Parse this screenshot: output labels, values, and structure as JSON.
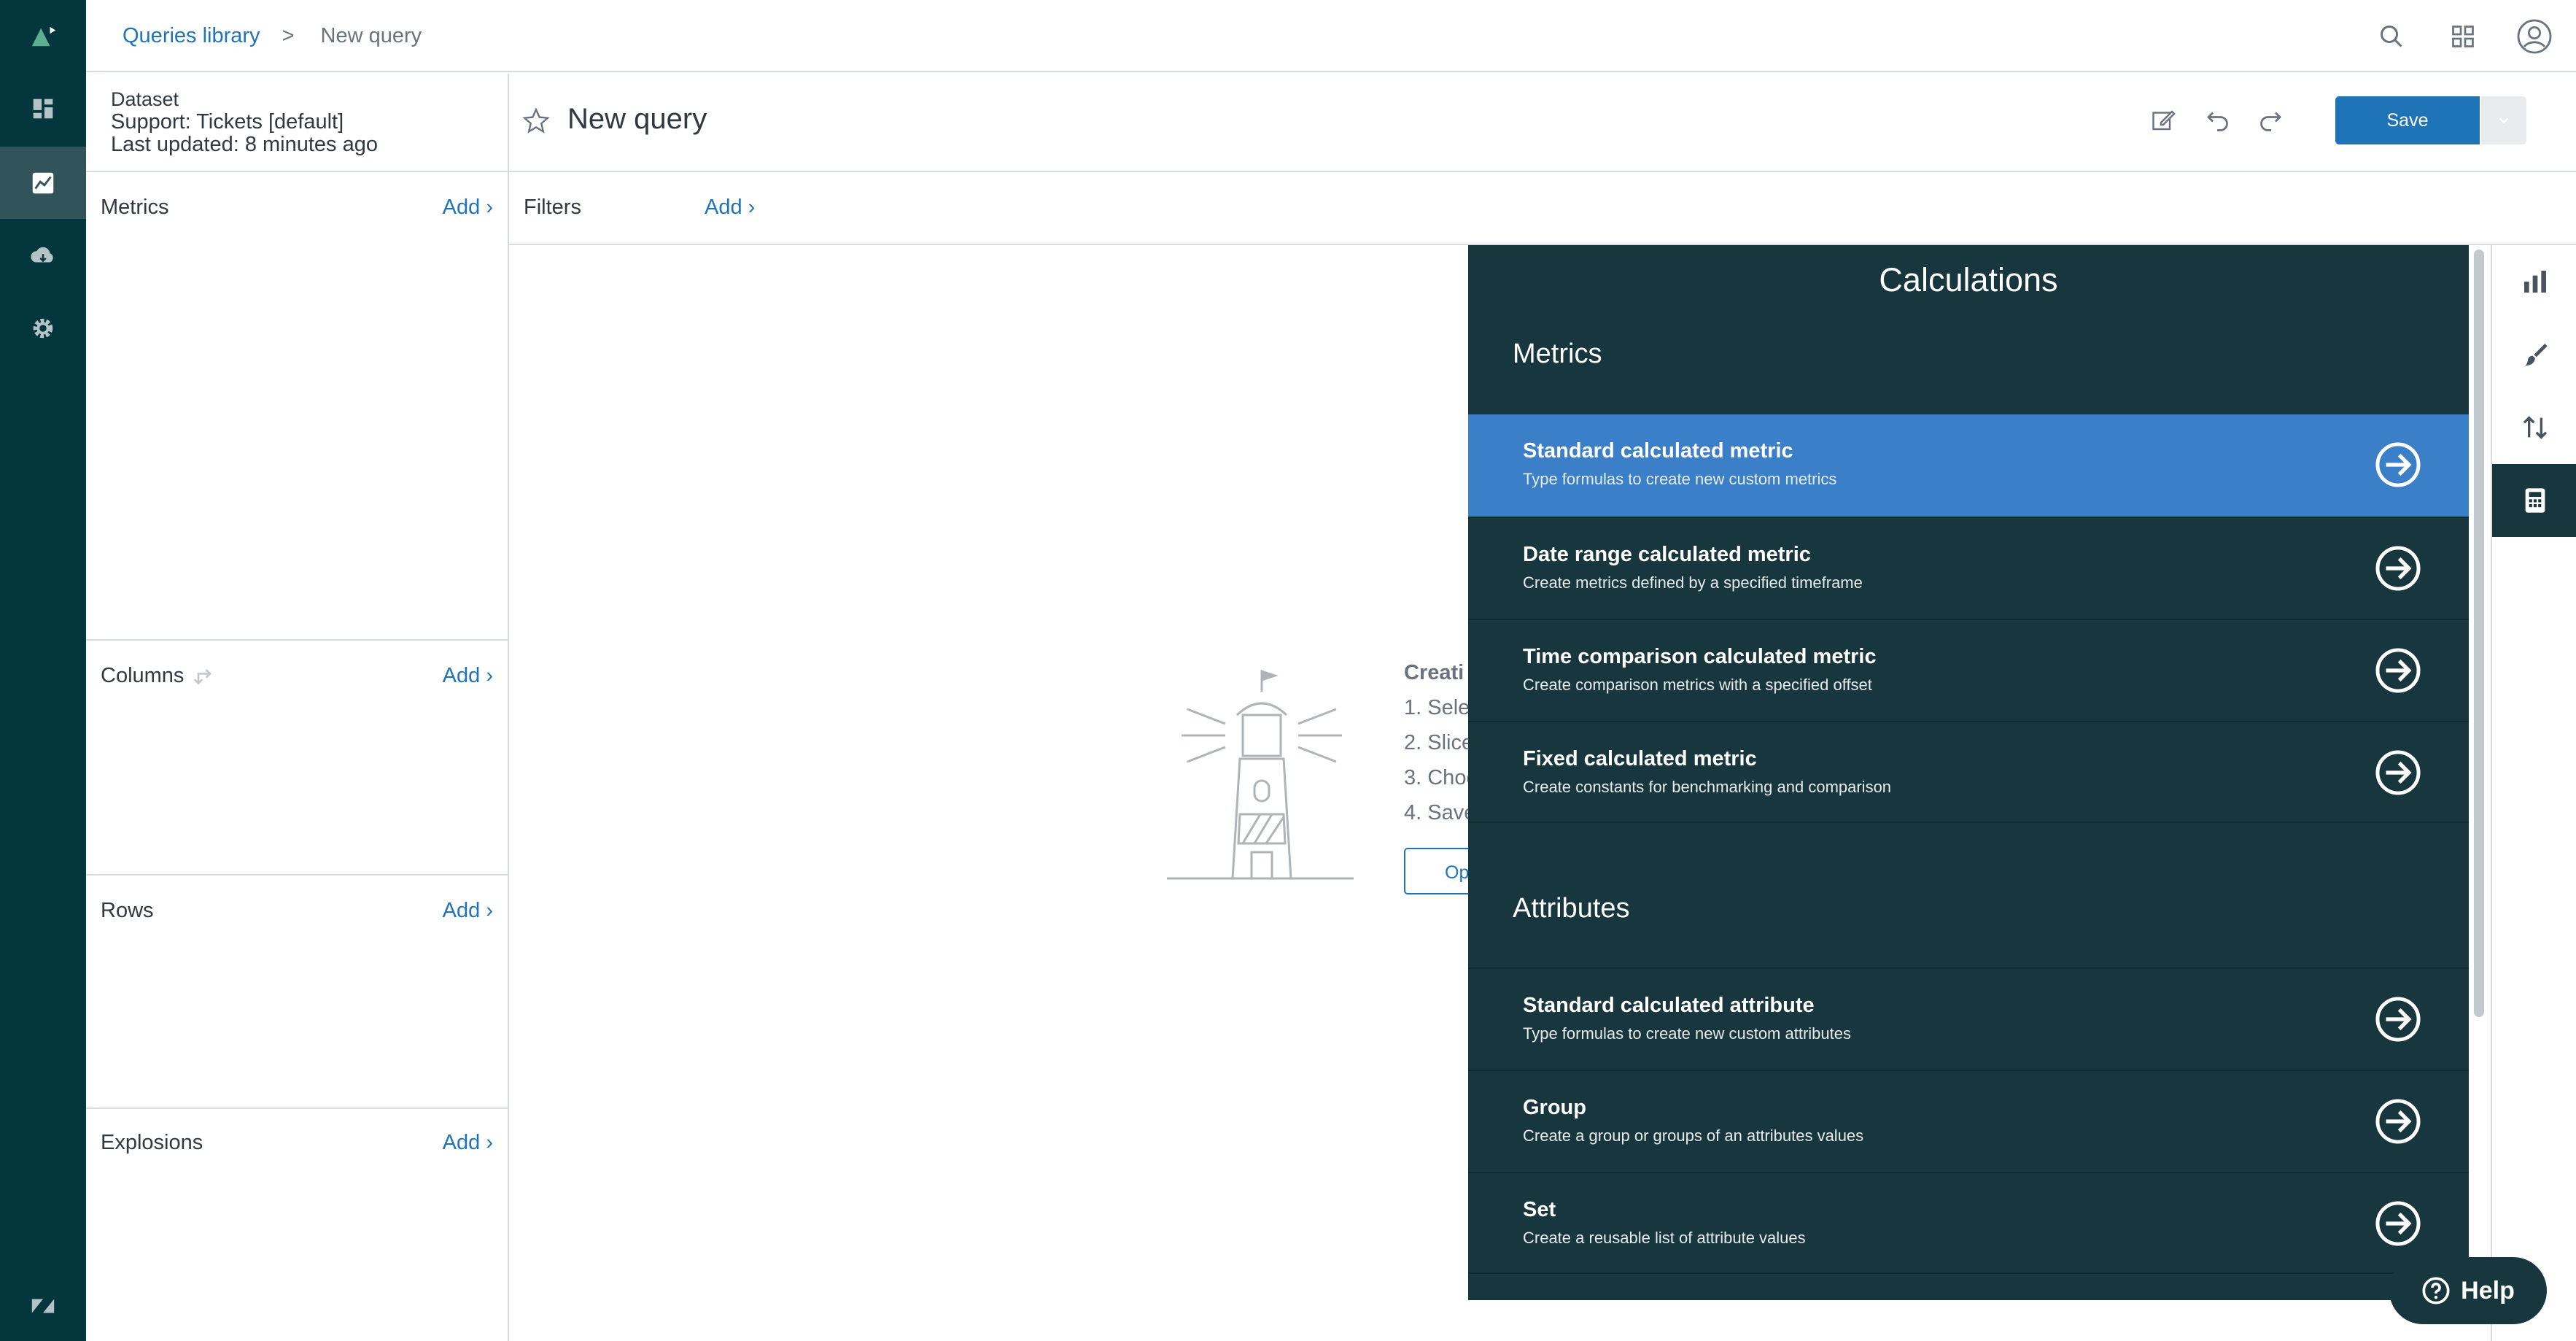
{
  "nav": {
    "items": [
      "logo-icon",
      "dashboard-icon",
      "queries-icon",
      "cloud-icon",
      "settings-icon"
    ],
    "active": "queries-icon",
    "footer_icon": "zendesk-logo-icon"
  },
  "breadcrumb": {
    "link": "Queries library",
    "separator": ">",
    "current": "New query"
  },
  "dataset": {
    "label": "Dataset",
    "name": "Support: Tickets [default]",
    "updated": "Last updated: 8 minutes ago"
  },
  "query": {
    "title": "New query",
    "save_label": "Save"
  },
  "left_panel": {
    "metrics": {
      "label": "Metrics",
      "add": "Add ›"
    },
    "columns": {
      "label": "Columns",
      "add": "Add ›"
    },
    "rows": {
      "label": "Rows",
      "add": "Add ›"
    },
    "explosions": {
      "label": "Explosions",
      "add": "Add ›"
    }
  },
  "filters": {
    "label": "Filters",
    "add": "Add ›"
  },
  "empty_state": {
    "title": "Creati",
    "steps": [
      "1. Selec",
      "2. Slice",
      "3. Choo",
      "4. Save"
    ],
    "button": "Op"
  },
  "calculations": {
    "title": "Calculations",
    "metrics_heading": "Metrics",
    "attributes_heading": "Attributes",
    "metrics": [
      {
        "title": "Standard calculated metric",
        "desc": "Type formulas to create new custom metrics"
      },
      {
        "title": "Date range calculated metric",
        "desc": "Create metrics defined by a specified timeframe"
      },
      {
        "title": "Time comparison calculated metric",
        "desc": "Create comparison metrics with a specified offset"
      },
      {
        "title": "Fixed calculated metric",
        "desc": "Create constants for benchmarking and comparison"
      }
    ],
    "attributes": [
      {
        "title": "Standard calculated attribute",
        "desc": "Type formulas to create new custom attributes"
      },
      {
        "title": "Group",
        "desc": "Create a group or groups of an attributes values"
      },
      {
        "title": "Set",
        "desc": "Create a reusable list of attribute values"
      }
    ]
  },
  "right_rail": [
    "chart-icon",
    "paintbrush-icon",
    "sort-icon",
    "calculator-icon"
  ],
  "help": {
    "label": "Help"
  },
  "colors": {
    "nav_bg": "#03363d",
    "panel_bg": "#17363e",
    "accent": "#1f73b7",
    "active_item": "#3a7fc8"
  }
}
